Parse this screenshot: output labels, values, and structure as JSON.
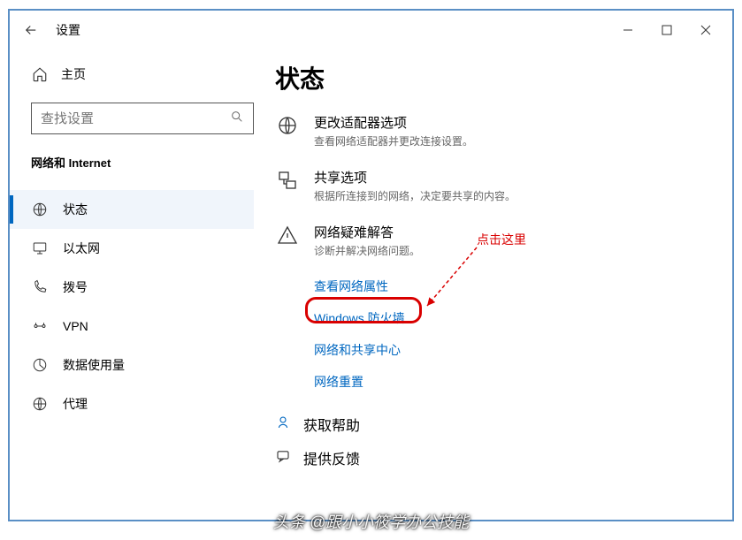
{
  "titlebar": {
    "title": "设置"
  },
  "sidebar": {
    "home": "主页",
    "search_placeholder": "查找设置",
    "section": "网络和 Internet",
    "items": [
      {
        "label": "状态"
      },
      {
        "label": "以太网"
      },
      {
        "label": "拨号"
      },
      {
        "label": "VPN"
      },
      {
        "label": "数据使用量"
      },
      {
        "label": "代理"
      }
    ]
  },
  "main": {
    "heading": "状态",
    "rows": [
      {
        "title": "更改适配器选项",
        "desc": "查看网络适配器并更改连接设置。"
      },
      {
        "title": "共享选项",
        "desc": "根据所连接到的网络，决定要共享的内容。"
      },
      {
        "title": "网络疑难解答",
        "desc": "诊断并解决网络问题。"
      }
    ],
    "links": [
      "查看网络属性",
      "Windows 防火墙",
      "网络和共享中心",
      "网络重置"
    ],
    "footer": [
      "获取帮助",
      "提供反馈"
    ]
  },
  "annotation": {
    "callout": "点击这里"
  },
  "watermark": "头条 @跟小小筱学办公技能"
}
